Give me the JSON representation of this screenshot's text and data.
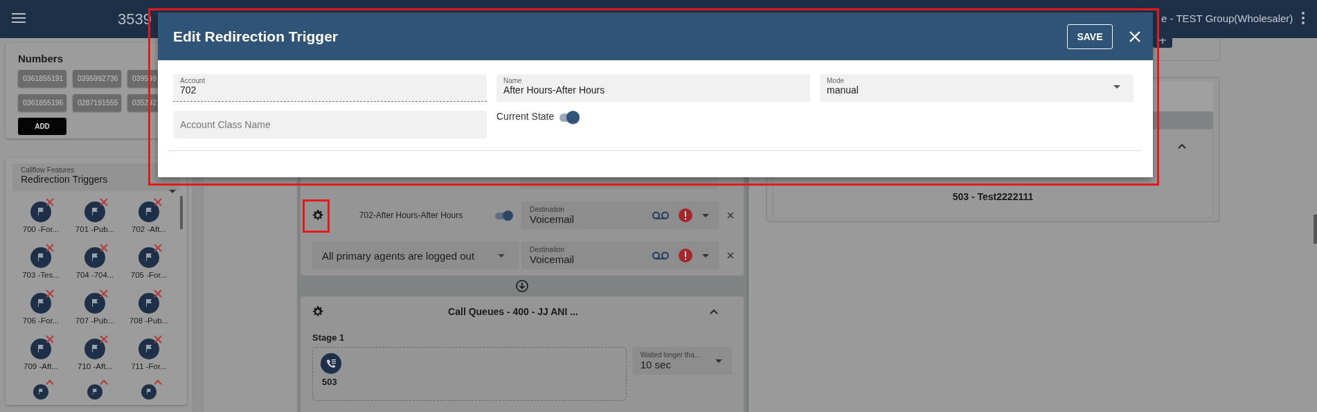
{
  "header": {
    "title": "3539",
    "account": "e - TEST Group(Wholesaler)"
  },
  "numbers_panel": {
    "title": "Numbers",
    "numbers": [
      "0361855191",
      "0395992736",
      "039599",
      "0361855196",
      "0287191555",
      "035292"
    ],
    "add_button": "ADD"
  },
  "features_panel": {
    "select_label": "Callflow Features",
    "select_value": "Redirection Triggers",
    "items": [
      {
        "label": "700 -For...",
        "cut_off": false
      },
      {
        "label": "701 -Pub...",
        "cut_off": false
      },
      {
        "label": "702 -Aft...",
        "cut_off": false
      },
      {
        "label": "703 -Tes...",
        "cut_off": false
      },
      {
        "label": "704 -704...",
        "cut_off": false
      },
      {
        "label": "705 -For...",
        "cut_off": false
      },
      {
        "label": "706 -For...",
        "cut_off": false
      },
      {
        "label": "707 -Pub...",
        "cut_off": false
      },
      {
        "label": "708 -Pub...",
        "cut_off": false
      },
      {
        "label": "709 -Aft...",
        "cut_off": false
      },
      {
        "label": "710 -Aft...",
        "cut_off": false
      },
      {
        "label": "711 -For...",
        "cut_off": false
      },
      {
        "cut_off": true
      },
      {
        "cut_off": true
      },
      {
        "cut_off": true
      }
    ]
  },
  "canvas": {
    "trigger_rows": [
      {
        "kind": "named",
        "name": "702-After Hours-After Hours",
        "enabled": true,
        "destination_label": "Destination",
        "destination": "Voicemail"
      },
      {
        "kind": "condition",
        "condition": "All primary agents are logged out",
        "destination_label": "Destination",
        "destination": "Voicemail"
      }
    ],
    "queue_card": {
      "title": "Call Queues - 400 - JJ ANI ...",
      "stage": "Stage 1",
      "member": "503",
      "wait_label": "Waited longer tha...",
      "wait_value": "10 sec"
    },
    "right_card": {
      "label": "503 - Test2222111"
    }
  },
  "dialog": {
    "title": "Edit Redirection Trigger",
    "save_button": "SAVE",
    "fields": [
      {
        "kind": "text",
        "label": "Account",
        "value": "702",
        "disabled": true
      },
      {
        "kind": "text",
        "label": "Name",
        "value": "After Hours-After Hours",
        "disabled": false
      },
      {
        "kind": "select",
        "label": "Mode",
        "value": "manual",
        "disabled": false
      },
      {
        "kind": "text",
        "placeholder": "Account Class Name",
        "disabled": false
      }
    ],
    "current_state": {
      "label": "Current State",
      "on": true
    }
  }
}
